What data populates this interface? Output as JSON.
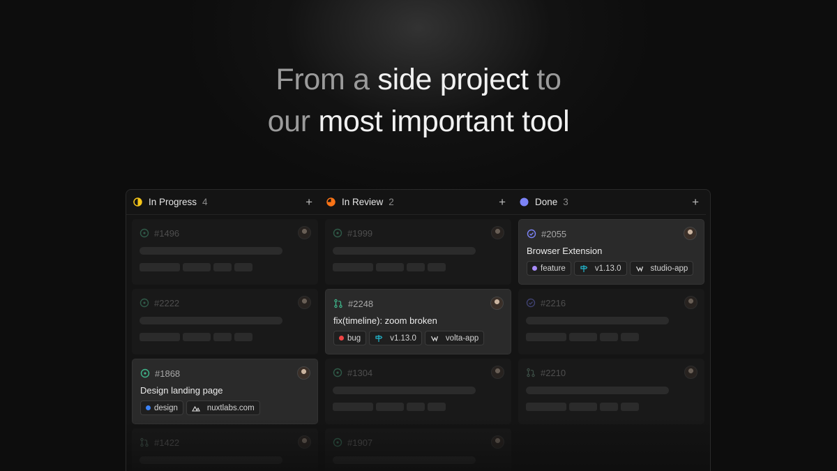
{
  "hero": {
    "line1": [
      {
        "text": "From a ",
        "style": "muted"
      },
      {
        "text": "side project",
        "style": "strong"
      },
      {
        "text": " to",
        "style": "muted"
      }
    ],
    "line2": [
      {
        "text": "our ",
        "style": "muted"
      },
      {
        "text": "most important tool",
        "style": "strong"
      }
    ]
  },
  "columns": [
    {
      "title": "In Progress",
      "count": "4",
      "status_color": "#f5c518",
      "status_icon": "half-circle-icon",
      "cards": [
        {
          "id": "#1496",
          "state": "faded",
          "icon": "circle-dot-icon"
        },
        {
          "id": "#2222",
          "state": "faded",
          "icon": "circle-dot-icon"
        },
        {
          "id": "#1868",
          "state": "active",
          "icon": "circle-dot-icon",
          "title": "Design landing page",
          "chips": [
            {
              "label": "design",
              "icon": "dot",
              "color": "#3b82f6"
            },
            {
              "label": "nuxtlabs.com",
              "icon": "nuxt-icon"
            }
          ]
        },
        {
          "id": "#1422",
          "state": "faded",
          "icon": "pull-request-icon"
        }
      ]
    },
    {
      "title": "In Review",
      "count": "2",
      "status_color": "#f97316",
      "status_icon": "pie-circle-icon",
      "cards": [
        {
          "id": "#1999",
          "state": "faded",
          "icon": "circle-dot-icon"
        },
        {
          "id": "#2248",
          "state": "active",
          "icon": "pull-request-icon",
          "title": "fix(timeline): zoom broken",
          "chips": [
            {
              "label": "bug",
              "icon": "dot",
              "color": "#ef4444"
            },
            {
              "label": "v1.13.0",
              "icon": "signpost-icon",
              "color": "#22b8cf"
            },
            {
              "label": "volta-app",
              "icon": "volta-icon"
            }
          ]
        },
        {
          "id": "#1304",
          "state": "faded",
          "icon": "circle-dot-icon"
        },
        {
          "id": "#1907",
          "state": "faded",
          "icon": "circle-dot-icon"
        }
      ]
    },
    {
      "title": "Done",
      "count": "3",
      "status_color": "#7c83f7",
      "status_icon": "filled-circle-icon",
      "cards": [
        {
          "id": "#2055",
          "state": "active",
          "icon": "check-circle-icon",
          "title": "Browser Extension",
          "chips": [
            {
              "label": "feature",
              "icon": "dot",
              "color": "#a78bfa"
            },
            {
              "label": "v1.13.0",
              "icon": "signpost-icon",
              "color": "#22b8cf"
            },
            {
              "label": "studio-app",
              "icon": "volta-icon"
            }
          ]
        },
        {
          "id": "#2216",
          "state": "faded",
          "icon": "check-circle-icon"
        },
        {
          "id": "#2210",
          "state": "faded",
          "icon": "pull-request-icon"
        }
      ]
    }
  ],
  "colors": {
    "accent_green": "#3fb68b",
    "done_purple": "#7c83f7"
  }
}
